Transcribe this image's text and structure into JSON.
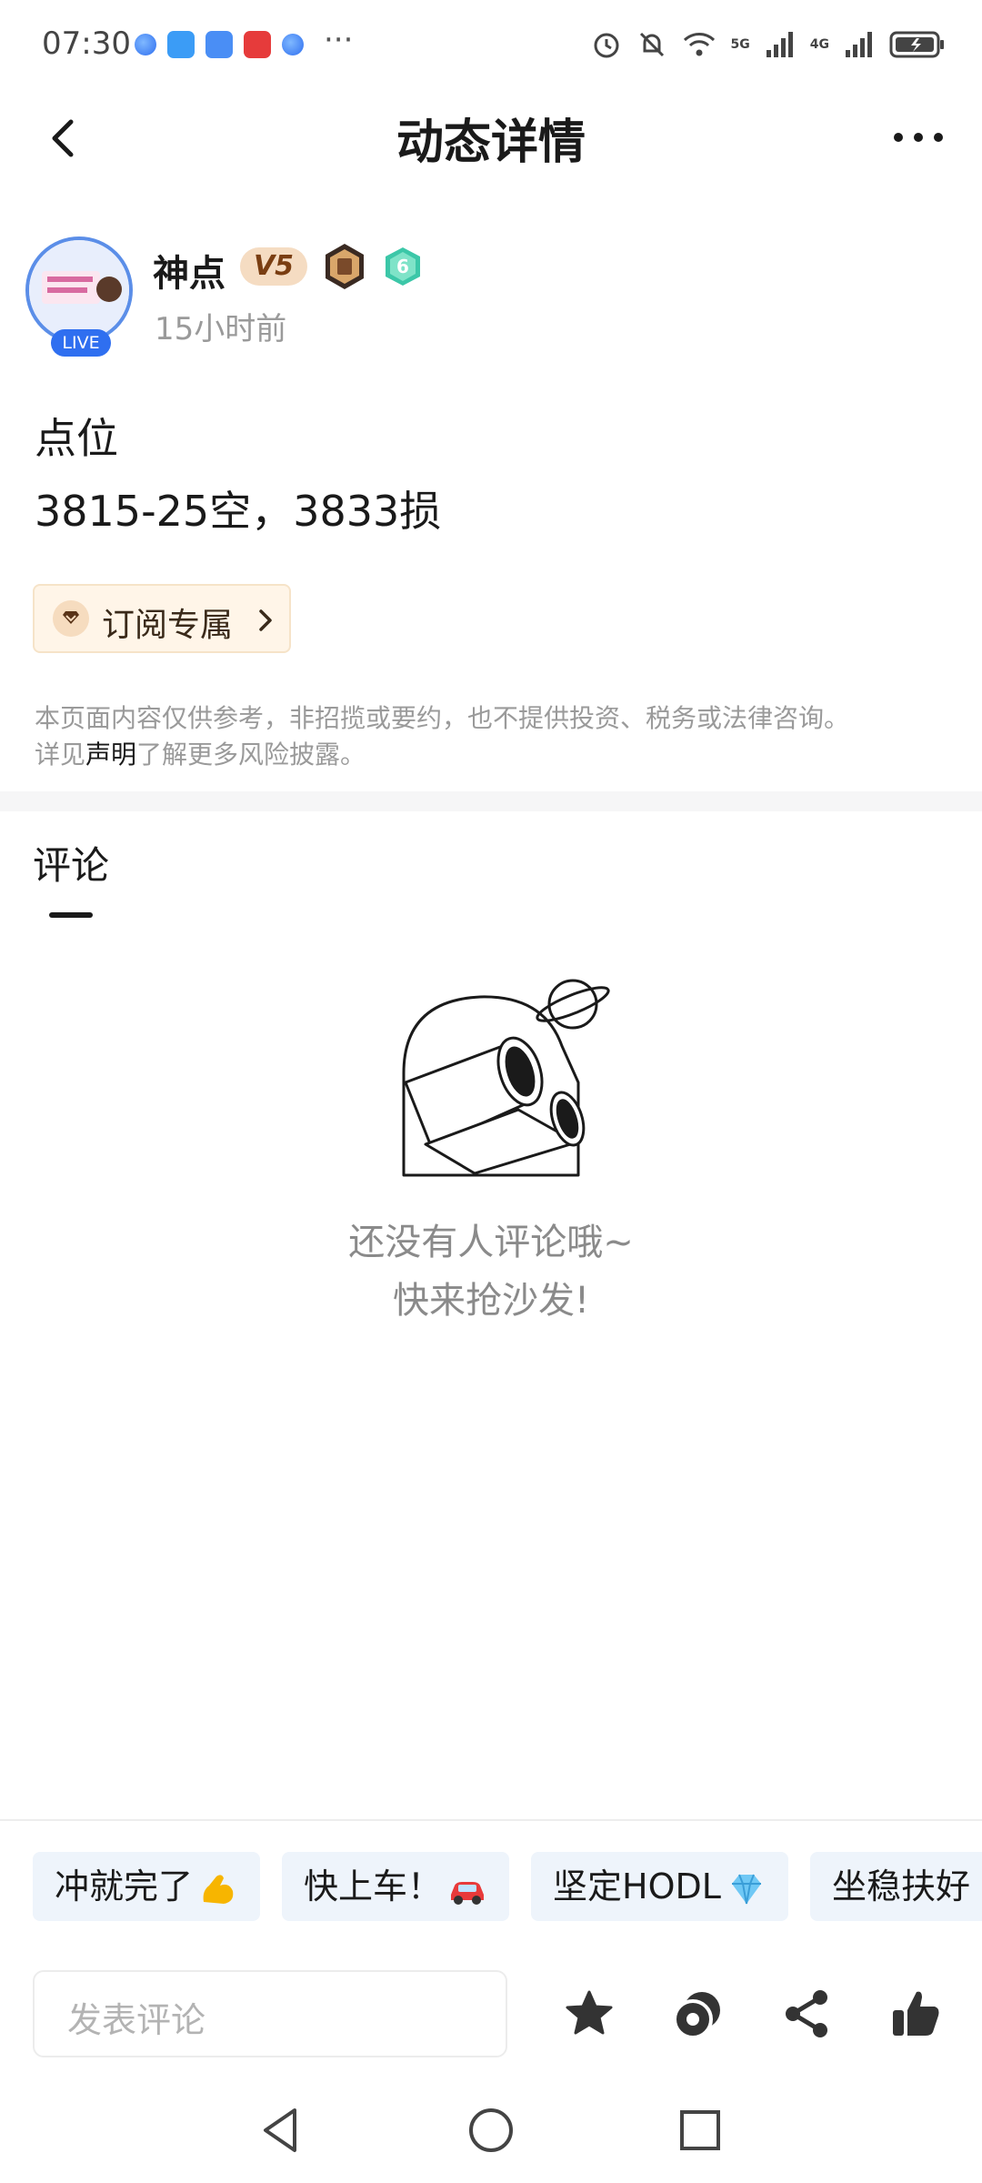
{
  "status_bar": {
    "time": "07:30",
    "more": "···",
    "network": [
      "5G",
      "4G"
    ],
    "icons": [
      "alarm-icon",
      "mute-icon",
      "wifi-icon",
      "signal-icon",
      "battery-icon"
    ]
  },
  "header": {
    "title": "动态详情",
    "back_icon": "chevron-left-icon",
    "more_icon": "more-dots-icon"
  },
  "author": {
    "name": "神点",
    "vip_level": "V5",
    "level": "6",
    "time_ago": "15小时前",
    "live_label": "LIVE"
  },
  "post": {
    "title": "点位",
    "body": "3815-25空，3833损",
    "subscribe_label": "订阅专属"
  },
  "disclaimer": {
    "text": "本页面内容仅供参考，非招揽或要约，也不提供投资、税务或法律咨询。",
    "prefix": "详见",
    "link": "声明",
    "suffix": "了解更多风险披露。"
  },
  "comments": {
    "tab_label": "评论",
    "empty_line1": "还没有人评论哦~",
    "empty_line2": "快来抢沙发!"
  },
  "quick_replies": [
    {
      "label": "冲就完了",
      "emoji": "flexed-biceps"
    },
    {
      "label": "快上车！",
      "emoji": "red-car"
    },
    {
      "label": "坚定HODL",
      "emoji": "gem"
    },
    {
      "label": "坐稳扶好",
      "emoji": ""
    }
  ],
  "input": {
    "placeholder": "发表评论"
  },
  "actions": [
    "star-icon",
    "coin-icon",
    "share-icon",
    "thumbs-up-icon"
  ],
  "colors": {
    "accent": "#2f6ff0",
    "vip_bg": "#f5dcc2",
    "chip_bg": "#eef4fb",
    "subscribe_bg": "#fff5e8",
    "level_badge": "#3cc7a8"
  }
}
